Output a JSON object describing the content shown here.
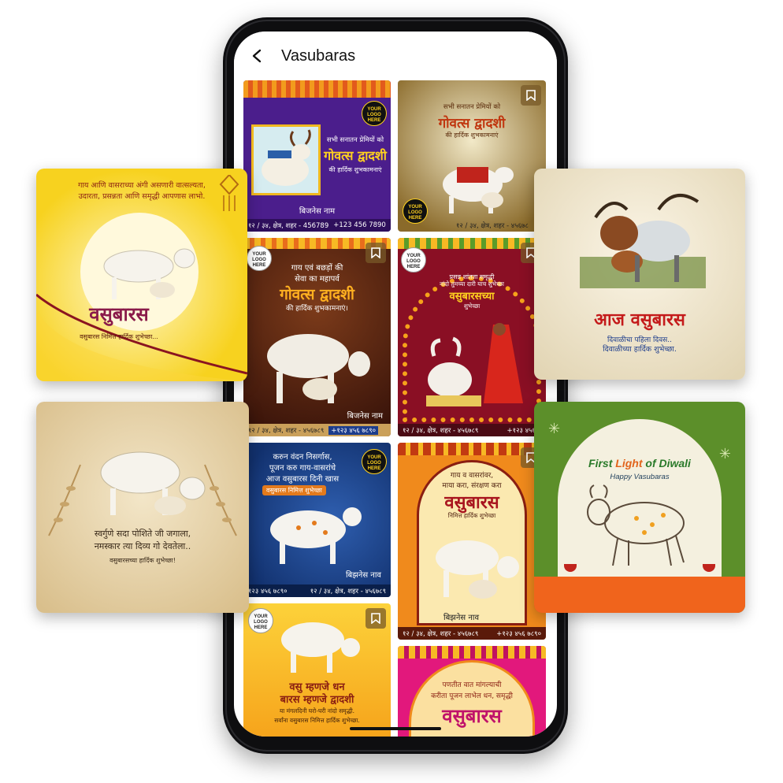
{
  "app": {
    "title": "Vasubaras",
    "back_icon": "arrow-left-icon"
  },
  "tiles": {
    "t1": {
      "logo": "YOUR LOGO HERE",
      "line1": "सभी सनातन प्रेमियों को",
      "line2": "गोवत्स द्वादशी",
      "line3": "की हार्दिक शुभकामनाएं",
      "business": "बिजनेस नाम",
      "address": "१२ / ३४, क्षेत्र, शहर - 456789",
      "phone": "+123 456 7890"
    },
    "t2": {
      "logo": "YOUR LOGO HERE",
      "line1": "सभी सनातन प्रेमियों को",
      "line2": "गोवत्स द्वादशी",
      "line3": "की हार्दिक शुभकामनाएं",
      "address": "१२ / ३४, क्षेत्र, शहर - ४५६७८"
    },
    "t3": {
      "logo": "YOUR LOGO HERE",
      "line1": "गाय एवं बछड़ों की",
      "line2": "सेवा का महापर्व",
      "line3": "गोवत्स द्वादशी",
      "line4": "की हार्दिक शुभकामनाएं।",
      "business": "बिजनेस नाम",
      "address": "१२ / ३४, क्षेत्र, शहर - ४५६७८९",
      "phone": "+१२३ ४५६ ७८९०"
    },
    "t4": {
      "logo": "YOUR LOGO HERE",
      "line1": "प्रसन्न शांतता समृद्धी",
      "line2": "नांदो तुमच्या दारी याच शुभेच्छा",
      "line3": "वसुबारसच्या",
      "line4": "शुभेच्छा",
      "address": "१२ / ३४, क्षेत्र, शहर - ४५६७८९",
      "phone": "+१२३ ४५६ ७"
    },
    "t5": {
      "logo": "YOUR LOGO HERE",
      "line1": "करुन वंदन निसर्गास,",
      "line2": "पूजन करु गाय-वासरांचे",
      "line3": "आज वसुबारस दिनी खास",
      "line4": "वसुबारस निमित्त शुभेच्छा",
      "business": "बिझनेस नाव",
      "address": "१२ / ३४, क्षेत्र, शहर - ४५६७८९",
      "phone": "१२३ ४५६ ७८९०"
    },
    "t6": {
      "line1": "गाय व वासरांवर,",
      "line2": "माया करा, संरक्षण करा",
      "line3": "वसुबारस",
      "line4": "निमित्त हार्दिक शुभेच्छा",
      "business": "बिझनेस नाव",
      "address": "१२ / ३४, क्षेत्र, शहर - ४५६७८९",
      "phone": "+१२३ ४५६ ७८९०"
    },
    "t7": {
      "logo": "YOUR LOGO HERE",
      "line1": "वसु म्हणजे धन",
      "line2": "बारस म्हणजे द्वादशी",
      "line3": "या मंगलदिनी घरो-घरी नांदो समृद्धी.",
      "line4": "सर्वांना वसुबारस निमित्त हार्दिक शुभेच्छा."
    },
    "t8": {
      "line1": "पणतीत वात मांगल्याची",
      "line2": "करीता पूजन लाभेल धन, समृद्धी",
      "line3": "वसुबारस"
    }
  },
  "cards": {
    "left_top": {
      "line1": "गाय आणि वासराच्या अंगी असणारी वात्सल्यता,",
      "line2": "उदारता, प्रसन्नता आणि समृद्धी आपणास लाभो.",
      "title": "वसुबारस",
      "subtitle": "वसुबारस निमित्त हार्दिक शुभेच्छा..."
    },
    "left_bottom": {
      "line1": "स्वर्गुणे सदा पोशिते जी जगाला,",
      "line2": "नमस्कार त्या दिव्य गो देवतेला..",
      "line3": "वसुबारसच्या हार्दिक शुभेच्छा!"
    },
    "right_top": {
      "title": "आज वसुबारस",
      "line1": "दिवाळीचा पहिला दिवस..",
      "line2": "दिवाळीच्या हार्दिक शुभेच्छा."
    },
    "right_bottom": {
      "title_a": "First ",
      "title_b": "Light",
      "title_c": " of Diwali",
      "subtitle": "Happy Vasubaras"
    }
  },
  "colors": {
    "purple": "#4b1e8c",
    "maroon": "#7a1420",
    "saffron": "#f4a21b",
    "green": "#5c8f2a",
    "cream": "#efe3c6"
  }
}
